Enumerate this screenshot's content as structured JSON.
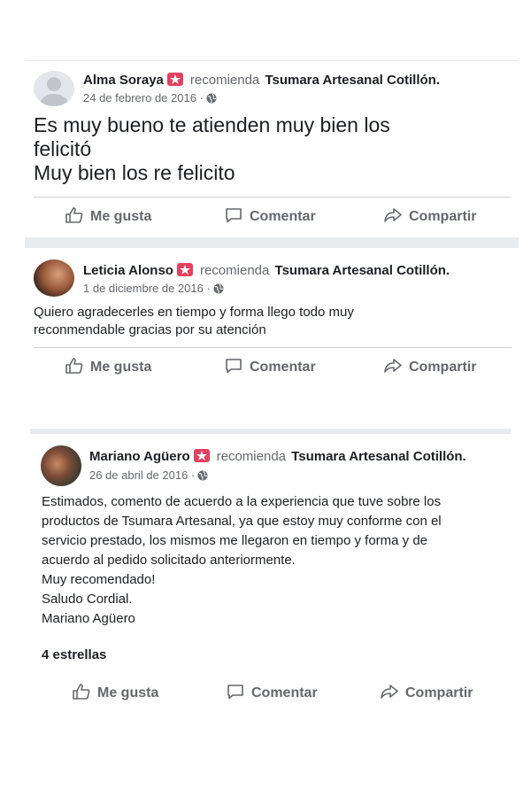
{
  "posts": [
    {
      "author": "Alma Soraya",
      "recommends": "recomienda",
      "page": "Tsumara Artesanal Cotillón.",
      "date": "24 de febrero de 2016 ·",
      "body": "Es muy bueno te atienden muy bien los\nfelicitó\nMuy bien los re felicito",
      "like": "Me gusta",
      "comment": "Comentar",
      "share": "Compartir"
    },
    {
      "author": "Leticia Alonso",
      "recommends": "recomienda",
      "page": "Tsumara Artesanal Cotillón.",
      "date": "1 de diciembre de 2016 ·",
      "body": "Quiero agradecerles en tiempo y forma llego todo muy\nreconmendable gracias por su atención",
      "like": "Me gusta",
      "comment": "Comentar",
      "share": "Compartir"
    },
    {
      "author": "Mariano Agüero",
      "recommends": "recomienda",
      "page": "Tsumara Artesanal Cotillón.",
      "date": "26 de abril de 2016 ·",
      "body": "Estimados, comento de acuerdo a la experiencia que tuve sobre los\nproductos de Tsumara Artesanal, ya que estoy muy conforme con el\nservicio prestado, los mismos me llegaron en tiempo y forma y de\nacuerdo al pedido solicitado anteriormente.\nMuy recomendado!\nSaludo Cordial.\nMariano Agüero",
      "rating": "4 estrellas",
      "like": "Me gusta",
      "comment": "Comentar",
      "share": "Compartir"
    }
  ],
  "colors": {
    "badge": "#e4405f",
    "action_text": "#65676b",
    "secondary_text": "#65676b"
  },
  "icons": [
    "recommend-badge-icon",
    "globe-icon",
    "like-thumb-icon",
    "comment-bubble-icon",
    "share-arrow-icon"
  ]
}
